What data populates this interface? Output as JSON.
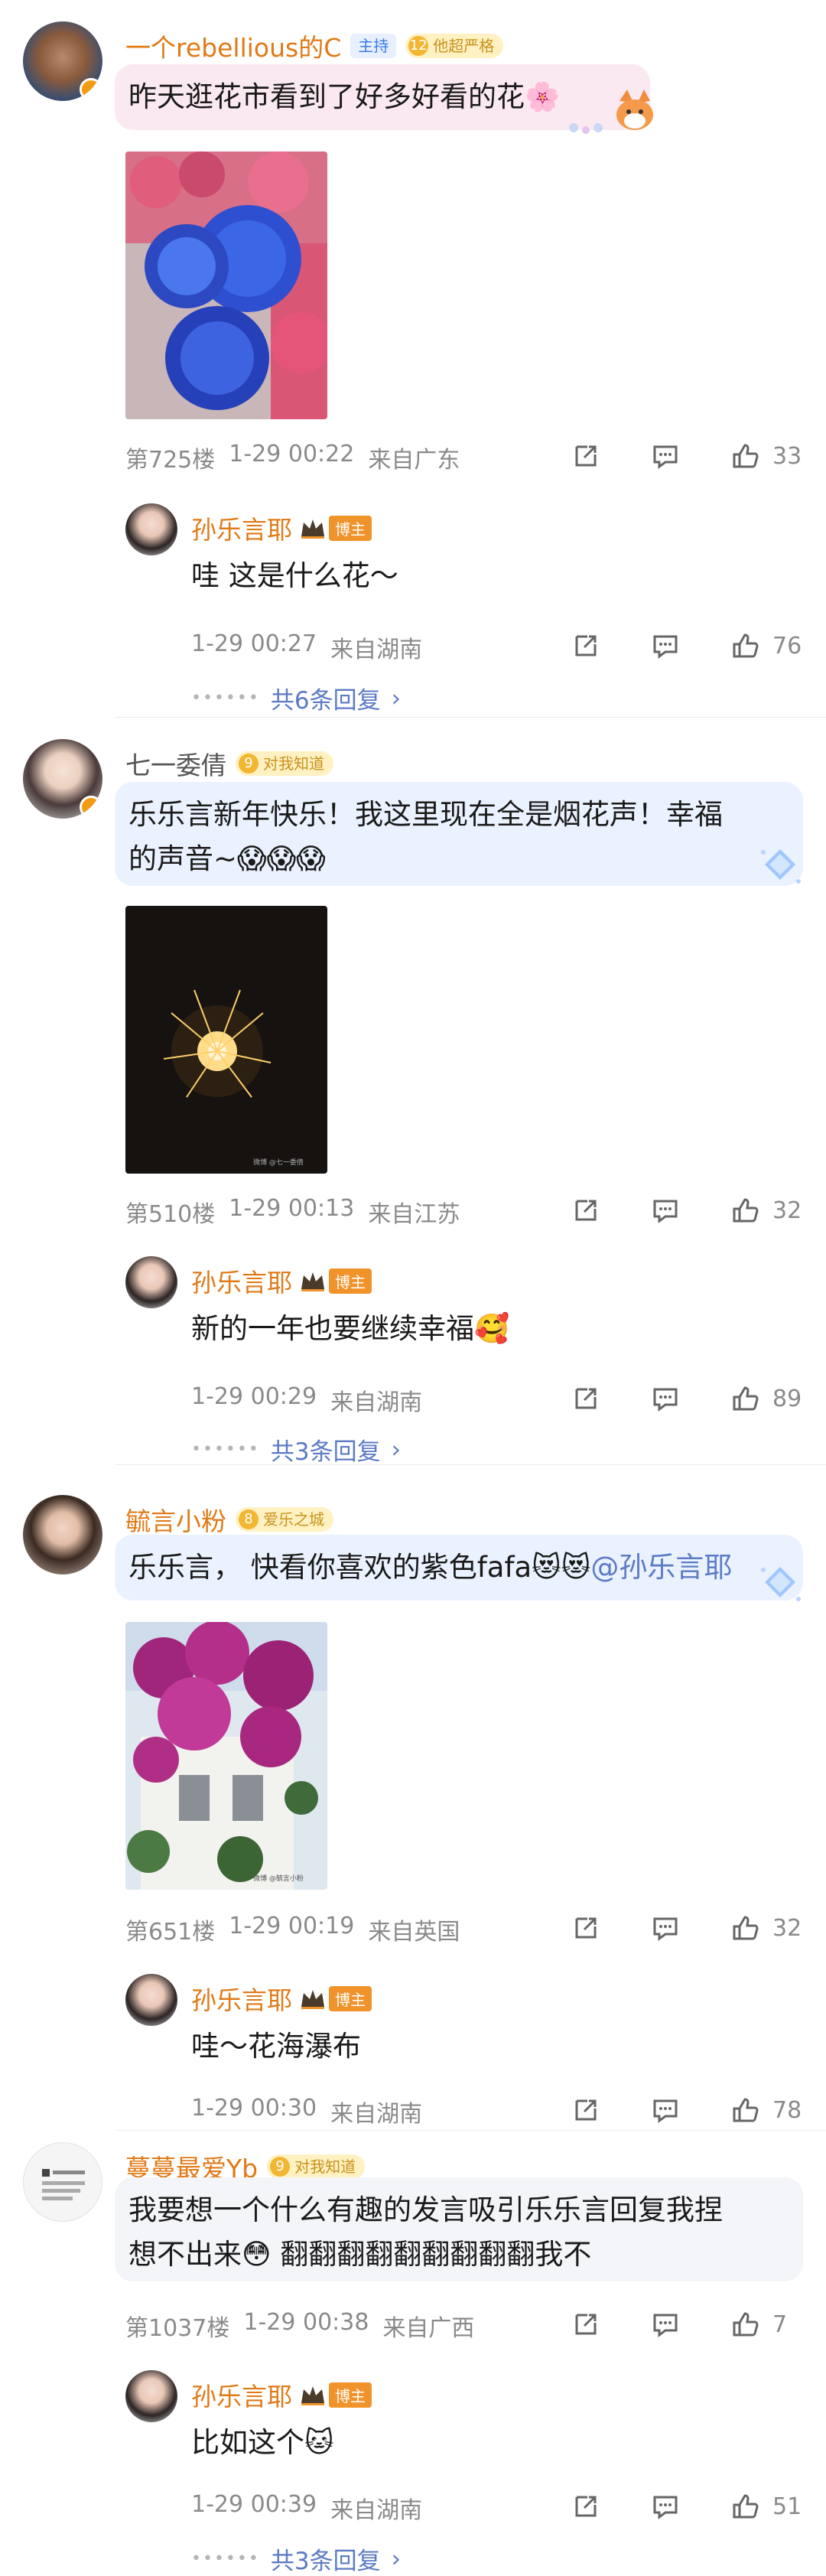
{
  "comments": [
    {
      "username": "一个rebellious的C",
      "badge_host": "主持",
      "fan_badge": {
        "level": "12",
        "label": "他超严格"
      },
      "text": "昨天逛花市看到了好多好看的花🌸",
      "floor": "第725楼",
      "time": "1-29 00:22",
      "location": "来自广东",
      "likes": "33",
      "reply": {
        "username": "孙乐言耶",
        "badge": "博主",
        "text": "哇 这是什么花～",
        "time": "1-29 00:27",
        "location": "来自湖南",
        "likes": "76",
        "more": "共6条回复"
      }
    },
    {
      "username": "七一委倩",
      "fan_badge": {
        "level": "9",
        "label": "对我知道"
      },
      "text_line1": "乐乐言新年快乐！我这里现在全是烟花声！幸福",
      "text_line2": "的声音~😱😱😱",
      "photo_watermark": "微博 @七一委倩",
      "floor": "第510楼",
      "time": "1-29 00:13",
      "location": "来自江苏",
      "likes": "32",
      "reply": {
        "username": "孙乐言耶",
        "badge": "博主",
        "text": "新的一年也要继续幸福🥰",
        "time": "1-29 00:29",
        "location": "来自湖南",
        "likes": "89",
        "more": "共3条回复"
      }
    },
    {
      "username": "毓言小粉",
      "fan_badge": {
        "level": "8",
        "label": "爱乐之城"
      },
      "text_main": "乐乐言， 快看你喜欢的紫色fafa😻😻",
      "mention": "@孙乐言耶",
      "photo_watermark": "微博 @毓言小粉",
      "floor": "第651楼",
      "time": "1-29 00:19",
      "location": "来自英国",
      "likes": "32",
      "reply": {
        "username": "孙乐言耶",
        "badge": "博主",
        "text": "哇～花海瀑布",
        "time": "1-29 00:30",
        "location": "来自湖南",
        "likes": "78"
      }
    },
    {
      "username": "蔓蔓最爱Yb",
      "fan_badge": {
        "level": "9",
        "label": "对我知道"
      },
      "text_line1": "我要想一个什么有趣的发言吸引乐乐言回复我捏",
      "text_line2": "想不出来😳 翻翻翻翻翻翻翻翻翻我不",
      "floor": "第1037楼",
      "time": "1-29 00:38",
      "location": "来自广西",
      "likes": "7",
      "reply": {
        "username": "孙乐言耶",
        "badge": "博主",
        "text": "比如这个🐱",
        "time": "1-29 00:39",
        "location": "来自湖南",
        "likes": "51",
        "more": "共3条回复"
      }
    }
  ],
  "icons": [
    "share-icon",
    "comment-icon",
    "like-icon",
    "crown-icon"
  ],
  "colors": {
    "username": "#e07a17",
    "link": "#5b7bc4",
    "meta": "#8a8a8a"
  }
}
